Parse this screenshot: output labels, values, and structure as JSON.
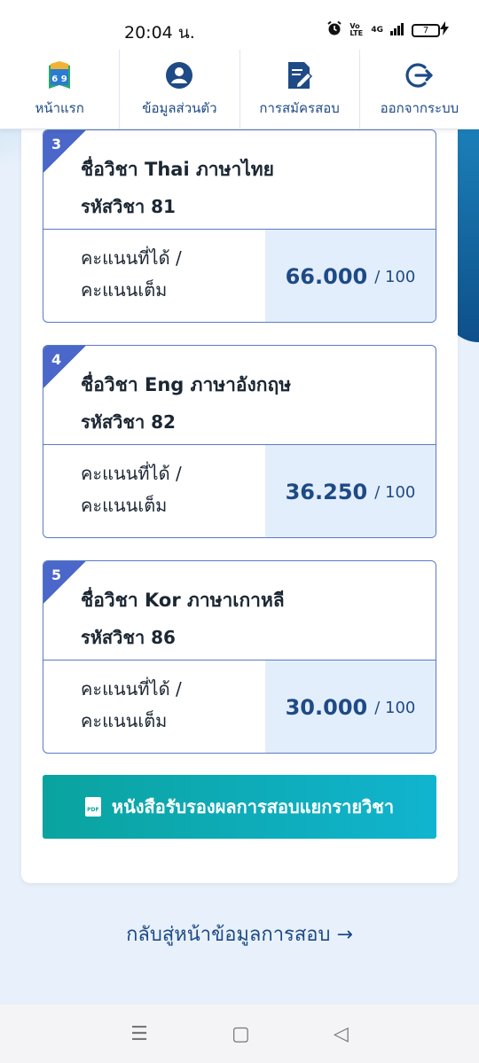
{
  "status_bar": {
    "time": "20:04 น.",
    "volte": "Vo LTE",
    "network": "4G",
    "battery": "7"
  },
  "nav": {
    "items": [
      {
        "label": "หน้าแรก",
        "icon": "home-book-icon",
        "icon_text": "6 9"
      },
      {
        "label": "ข้อมูลส่วนตัว",
        "icon": "user-icon"
      },
      {
        "label": "การสมัครสอบ",
        "icon": "edit-document-icon"
      },
      {
        "label": "ออกจากระบบ",
        "icon": "logout-icon"
      }
    ]
  },
  "subjects": [
    {
      "index": "3",
      "name": "ชื่อวิชา Thai ภาษาไทย",
      "code": "รหัสวิชา 81",
      "score_label_1": "คะแนนที่ได้ /",
      "score_label_2": "คะแนนเต็ม",
      "score": "66.000",
      "max": "/ 100"
    },
    {
      "index": "4",
      "name": "ชื่อวิชา Eng ภาษาอังกฤษ",
      "code": "รหัสวิชา 82",
      "score_label_1": "คะแนนที่ได้ /",
      "score_label_2": "คะแนนเต็ม",
      "score": "36.250",
      "max": "/ 100"
    },
    {
      "index": "5",
      "name": "ชื่อวิชา Kor ภาษาเกาหลี",
      "code": "รหัสวิชา 86",
      "score_label_1": "คะแนนที่ได้ /",
      "score_label_2": "คะแนนเต็ม",
      "score": "30.000",
      "max": "/ 100"
    }
  ],
  "certificate_button": {
    "label": "หนังสือรับรองผลการสอบแยกรายวิชา",
    "icon_text": "PDF"
  },
  "back_link": "กลับสู่หน้าข้อมูลการสอบ →",
  "android_nav": {
    "menu": "☰",
    "home": "▢",
    "back": "◁"
  },
  "colors": {
    "primary": "#1e4a86",
    "accent": "#4a67c9",
    "button": "#0aa39f",
    "score_bg": "#e3eefc"
  }
}
